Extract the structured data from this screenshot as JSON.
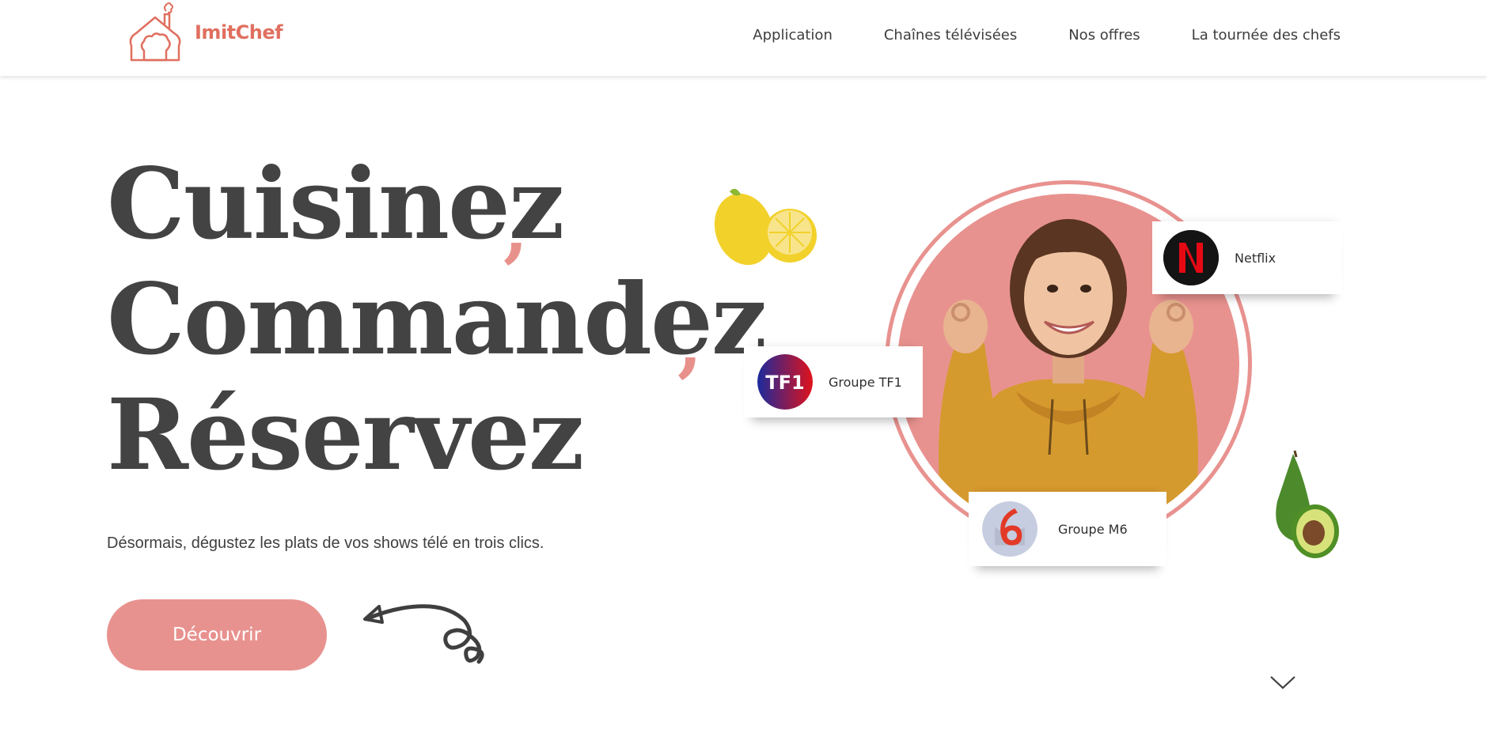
{
  "header": {
    "logo_text": "ImitChef",
    "nav": [
      {
        "label": "Application"
      },
      {
        "label": "Chaînes télévisées"
      },
      {
        "label": "Nos offres"
      },
      {
        "label": "La tournée des chefs"
      }
    ]
  },
  "hero": {
    "lines": [
      "Cuisinez",
      "Commandez",
      "Réservez"
    ],
    "separator": ",",
    "subtitle": "Désormais, dégustez les plats de vos shows télé en trois clics.",
    "cta_label": "Découvrir"
  },
  "channels": [
    {
      "name": "Netflix",
      "icon": "netflix-logo"
    },
    {
      "name": "Groupe TF1",
      "icon": "tf1-logo"
    },
    {
      "name": "Groupe M6",
      "icon": "m6-logo"
    }
  ],
  "colors": {
    "accent": "#e8928f",
    "logo": "#e06f5f",
    "heading": "#434343",
    "text": "#404040"
  }
}
